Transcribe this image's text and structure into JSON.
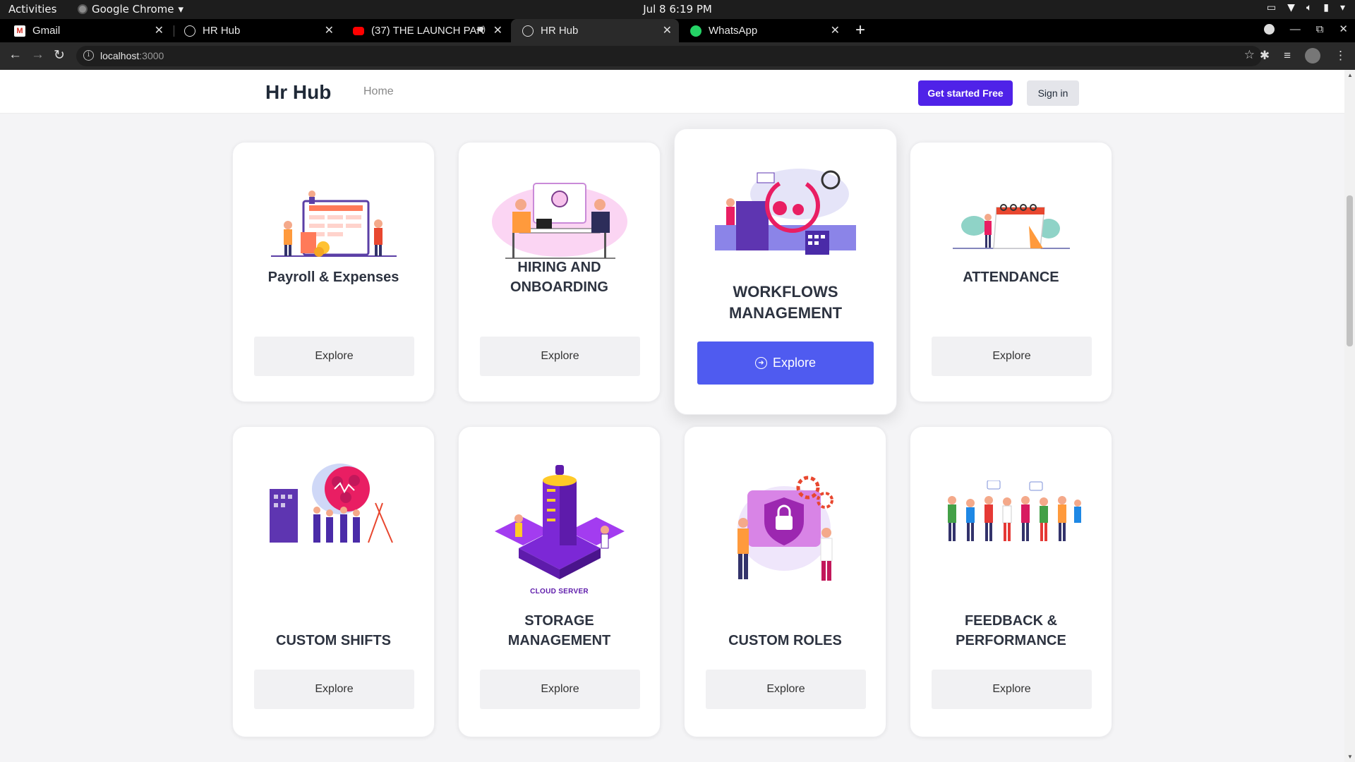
{
  "os": {
    "activities": "Activities",
    "app_name": "Google Chrome",
    "clock": "Jul 8  6:19 PM"
  },
  "tabs": [
    {
      "title": "Gmail",
      "icon": "gmail-icon"
    },
    {
      "title": "HR Hub",
      "icon": "globe-icon"
    },
    {
      "title": "(37) THE LAUNCH PAR",
      "icon": "youtube-icon"
    },
    {
      "title": "HR Hub",
      "icon": "globe-icon",
      "active": true
    },
    {
      "title": "WhatsApp",
      "icon": "whatsapp-icon"
    }
  ],
  "address_bar": {
    "host": "localhost",
    "port": ":3000"
  },
  "site": {
    "brand": "Hr Hub",
    "nav_home": "Home",
    "cta_primary": "Get started Free",
    "cta_signin": "Sign in",
    "accent": "#4f22e8",
    "featured_accent": "#4f5bf0"
  },
  "cards": [
    {
      "title": "Payroll & Expenses",
      "button": "Explore",
      "illustration": "payroll-illustration"
    },
    {
      "title": "HIRING AND ONBOARDING",
      "button": "Explore",
      "illustration": "hiring-illustration"
    },
    {
      "title": "WORKFLOWS MANAGEMENT",
      "button": "Explore",
      "illustration": "workflows-illustration",
      "featured": true
    },
    {
      "title": "ATTENDANCE",
      "button": "Explore",
      "illustration": "attendance-illustration"
    },
    {
      "title": "CUSTOM SHIFTS",
      "button": "Explore",
      "illustration": "shifts-illustration"
    },
    {
      "title": "STORAGE MANAGEMENT",
      "button": "Explore",
      "illustration": "storage-illustration",
      "caption": "CLOUD SERVER"
    },
    {
      "title": "CUSTOM ROLES",
      "button": "Explore",
      "illustration": "roles-illustration"
    },
    {
      "title": "FEEDBACK & PERFORMANCE",
      "button": "Explore",
      "illustration": "feedback-illustration"
    }
  ]
}
